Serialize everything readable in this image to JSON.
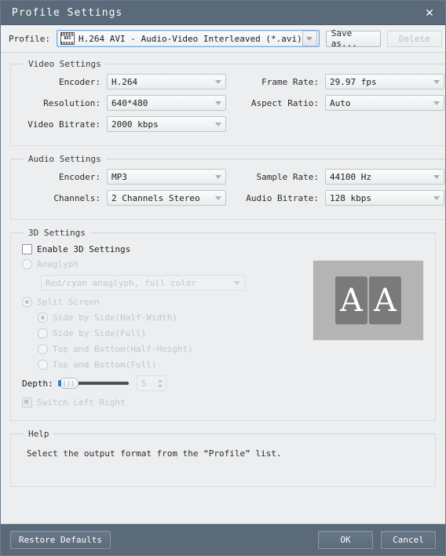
{
  "window": {
    "title": "Profile Settings",
    "close_icon": "close-icon"
  },
  "profile_bar": {
    "label": "Profile:",
    "icon_label": "AVI",
    "selected": "H.264 AVI - Audio-Video Interleaved (*.avi)",
    "save_as_label": "Save as...",
    "delete_label": "Delete"
  },
  "video_settings": {
    "legend": "Video Settings",
    "encoder_label": "Encoder:",
    "encoder_value": "H.264",
    "frame_rate_label": "Frame Rate:",
    "frame_rate_value": "29.97 fps",
    "resolution_label": "Resolution:",
    "resolution_value": "640*480",
    "aspect_ratio_label": "Aspect Ratio:",
    "aspect_ratio_value": "Auto",
    "video_bitrate_label": "Video Bitrate:",
    "video_bitrate_value": "2000 kbps"
  },
  "audio_settings": {
    "legend": "Audio Settings",
    "encoder_label": "Encoder:",
    "encoder_value": "MP3",
    "sample_rate_label": "Sample Rate:",
    "sample_rate_value": "44100 Hz",
    "channels_label": "Channels:",
    "channels_value": "2 Channels Stereo",
    "audio_bitrate_label": "Audio Bitrate:",
    "audio_bitrate_value": "128 kbps"
  },
  "three_d_settings": {
    "legend": "3D Settings",
    "enable_label": "Enable 3D Settings",
    "anaglyph_label": "Anaglyph",
    "anaglyph_value": "Red/cyan anaglyph, full color",
    "split_screen_label": "Split Screen",
    "split_options": [
      "Side by Side(Half-Width)",
      "Side by Side(Full)",
      "Top and Bottom(Half-Height)",
      "Top and Bottom(Full)"
    ],
    "depth_label": "Depth:",
    "depth_value": "5",
    "switch_label": "Switch Left Right",
    "preview_glyph_left": "A",
    "preview_glyph_right": "A"
  },
  "help": {
    "legend": "Help",
    "text": "Select the output format from the “Profile” list."
  },
  "footer": {
    "restore_label": "Restore Defaults",
    "ok_label": "OK",
    "cancel_label": "Cancel"
  }
}
